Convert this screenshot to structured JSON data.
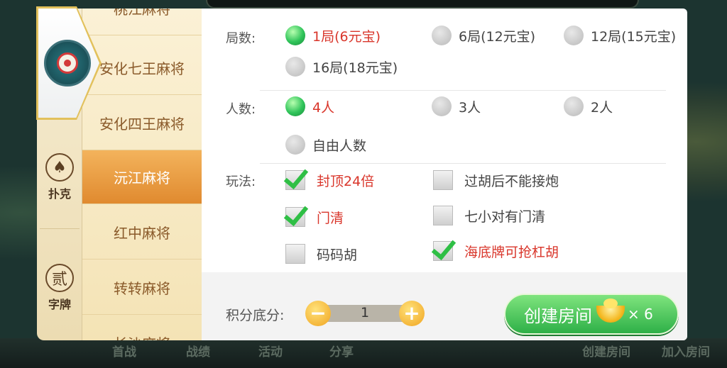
{
  "background": {
    "bottom_buttons": [
      "首战",
      "战绩",
      "活动",
      "分享",
      "创建房间",
      "加入房间"
    ]
  },
  "rail": {
    "tabs": [
      {
        "label": "",
        "icon": "mahjong-emblem-icon"
      },
      {
        "label": "扑克",
        "icon": "spade-icon",
        "glyph": "♠"
      },
      {
        "label": "字牌",
        "icon": "character-tile-icon",
        "glyph": "贰"
      }
    ]
  },
  "games": [
    "桃江麻将",
    "安化七王麻将",
    "安化四王麻将",
    "沅江麻将",
    "红中麻将",
    "转转麻将",
    "长沙麻将"
  ],
  "selected_game": "沅江麻将",
  "rounds": {
    "label": "局数:",
    "options": [
      "1局(6元宝)",
      "6局(12元宝)",
      "12局(15元宝)",
      "16局(18元宝)"
    ],
    "selected": 0
  },
  "players": {
    "label": "人数:",
    "options": [
      "4人",
      "3人",
      "2人",
      "自由人数"
    ],
    "selected": 0
  },
  "rules": {
    "label": "玩法:",
    "options": [
      {
        "label": "封顶24倍",
        "checked": true
      },
      {
        "label": "过胡后不能接炮",
        "checked": false
      },
      {
        "label": "门清",
        "checked": true
      },
      {
        "label": "七小对有门清",
        "checked": false
      },
      {
        "label": "码码胡",
        "checked": false
      },
      {
        "label": "海底牌可抢杠胡",
        "checked": true
      }
    ]
  },
  "score": {
    "label": "积分底分:",
    "value": "1",
    "minus": "−",
    "plus": "+"
  },
  "create": {
    "label": "创建房间",
    "cost": "× 6"
  },
  "colors": {
    "selected_text": "#d9362b",
    "accent_green": "#2eb048",
    "tab_orange": "#e08a2f"
  }
}
